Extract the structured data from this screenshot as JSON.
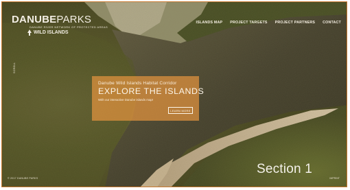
{
  "logo": {
    "brand_part1": "DANUBE",
    "brand_part2": "PARKS",
    "tagline": "DANUBE RIVER NETWORK OF PROTECTED AREAS",
    "sub": "WILD ISLANDS"
  },
  "nav": {
    "items": [
      {
        "label": "ISLANDS MAP"
      },
      {
        "label": "PROJECT TARGETS"
      },
      {
        "label": "PROJECT PARTNERS"
      },
      {
        "label": "CONTACT"
      }
    ]
  },
  "side_label": "SCROLL",
  "hero": {
    "eyebrow": "Danube Wild Islands Habitat Corridor",
    "headline": "EXPLORE THE ISLANDS",
    "caption": "With our interactive Danube islands map!",
    "cta_label": "LEARN MORE"
  },
  "footer": {
    "copyright": "© 2017 DANUBE PARKS",
    "right_text": "IMPRINT"
  },
  "section_label": "Section 1",
  "colors": {
    "accent": "#e2933e",
    "frame": "#c9782d",
    "forest": "#4f5227",
    "river": "#3a3a2a",
    "sand": "#c9b79a"
  }
}
